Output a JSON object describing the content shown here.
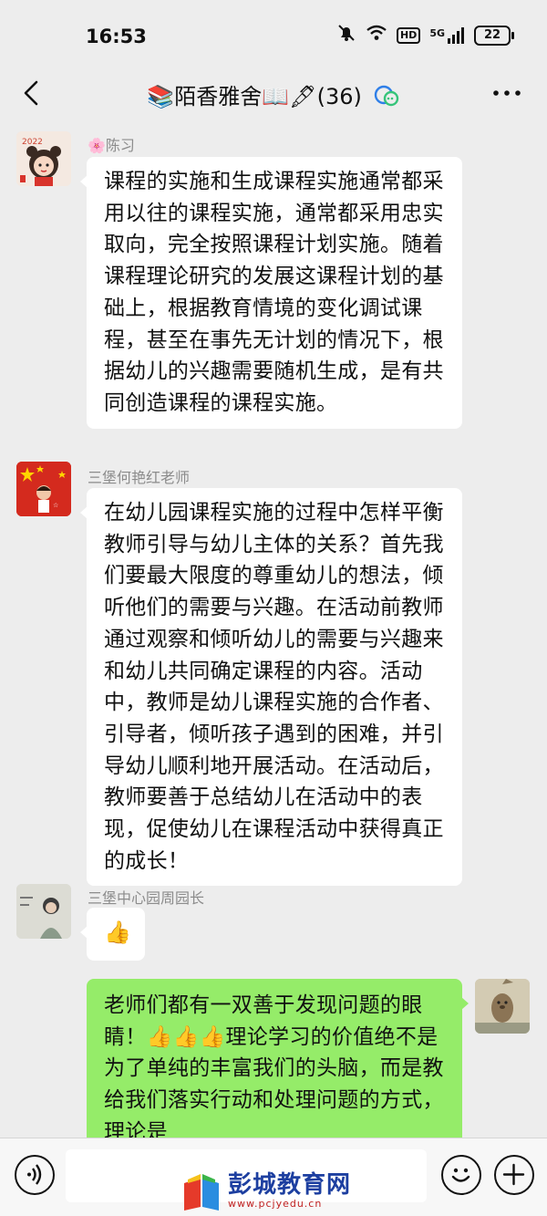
{
  "status_bar": {
    "time": "16:53",
    "network": "5G",
    "hd": "HD",
    "battery": "22"
  },
  "nav": {
    "title": "📚陌香雅舍📖🖋(36)",
    "back_icon": "chevron-left-icon",
    "more_icon": "more-dots-icon"
  },
  "messages": [
    {
      "sender": "🌸陈习",
      "text": "课程的实施和生成课程实施通常都采用以往的课程实施，通常都采用忠实取向，完全按照课程计划实施。随着课程理论研究的发展这课程计划的基础上，根据教育情境的变化调试课程，甚至在事先无计划的情况下，根据幼儿的兴趣需要随机生成，是有共同创造课程的课程实施。"
    },
    {
      "sender": "三堡何艳红老师",
      "text": "在幼儿园课程实施的过程中怎样平衡教师引导与幼儿主体的关系？首先我们要最大限度的尊重幼儿的想法，倾听他们的需要与兴趣。在活动前教师通过观察和倾听幼儿的需要与兴趣来和幼儿共同确定课程的内容。活动中，教师是幼儿课程实施的合作者、引导者，倾听孩子遇到的困难，并引导幼儿顺利地开展活动。在活动后，教师要善于总结幼儿在活动中的表现，促使幼儿在课程活动中获得真正的成长！"
    },
    {
      "sender": "三堡中心园周园长",
      "text": "👍"
    },
    {
      "sender": "",
      "text": "老师们都有一双善于发现问题的眼睛！👍👍👍理论学习的价值绝不是为了单纯的丰富我们的头脑，而是教给我们落实行动和处理问题的方式，理论是"
    }
  ],
  "watermark": {
    "name": "彭城教育网",
    "url": "www.pcjyedu.cn"
  },
  "colors": {
    "background": "#ededed",
    "bubble_mine": "#95ec69",
    "bubble_other": "#ffffff",
    "sender": "#8c8c8c"
  }
}
